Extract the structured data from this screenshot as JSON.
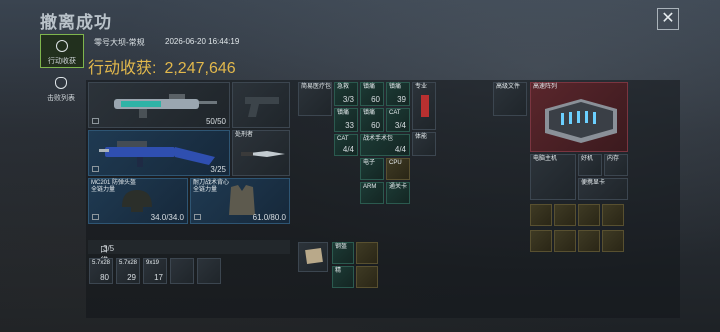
{
  "header": {
    "title": "撤离成功",
    "close_icon": "close-icon"
  },
  "nav": [
    {
      "label": "行动收获",
      "icon": "target-icon",
      "active": true
    },
    {
      "label": "击败列表",
      "icon": "skull-icon",
      "active": false
    }
  ],
  "summary": {
    "map": "零号大坝-常规",
    "datetime": "2026-06-20 16:44:19",
    "loot_label": "行动收获:",
    "loot_value": "2,247,646"
  },
  "equipment": {
    "primary_weapon": {
      "count": "50/50"
    },
    "secondary_weapon": {
      "count": "3/25"
    },
    "melee": {
      "label": "处刑者"
    },
    "helmet": {
      "label": "MC201 防弹头盔\n全链力量",
      "durability": "34.0/34.0"
    },
    "armor": {
      "label": "耐刀战术背心\n全链力量",
      "durability": "61.0/80.0"
    },
    "pocket": {
      "label": "口袋:",
      "count": "3/5",
      "items": [
        {
          "label": "5.7x28",
          "count": "80"
        },
        {
          "label": "5.7x28",
          "count": "29"
        },
        {
          "label": "9x19",
          "count": "17"
        }
      ]
    }
  },
  "backpack": {
    "items": [
      {
        "label": "简易医疗包",
        "count": ""
      },
      {
        "label": "急救",
        "count": "3/3"
      },
      {
        "label": "镇痛",
        "count": "60"
      },
      {
        "label": "镇痛",
        "count": "39"
      },
      {
        "label": "专业",
        "count": ""
      },
      {
        "label": "镇痛",
        "count": "33"
      },
      {
        "label": "镇痛",
        "count": "60"
      },
      {
        "label": "CAT",
        "count": "3/4"
      },
      {
        "label": "CAT",
        "count": "4/4"
      },
      {
        "label": "战术手术包",
        "count": "4/4"
      },
      {
        "label": "体能",
        "count": ""
      },
      {
        "label": "电子",
        "count": ""
      },
      {
        "label": "CPU",
        "count": ""
      },
      {
        "label": "ARM",
        "count": ""
      },
      {
        "label": "通关卡",
        "count": ""
      },
      {
        "label": "",
        "count": ""
      },
      {
        "label": "钢盔",
        "count": ""
      },
      {
        "label": "",
        "count": ""
      },
      {
        "label": "精",
        "count": ""
      },
      {
        "label": "",
        "count": ""
      }
    ]
  },
  "safebox": {
    "items": [
      {
        "label": "高级文件"
      },
      {
        "label": "高速阵列"
      },
      {
        "label": "电脑主机"
      },
      {
        "label": "好机"
      },
      {
        "label": "内存"
      },
      {
        "label": "便携显卡"
      }
    ]
  },
  "colors": {
    "accent_gold": "#e2b84c",
    "nav_active": "#7fb54d",
    "rare_red": "#7a3540"
  }
}
